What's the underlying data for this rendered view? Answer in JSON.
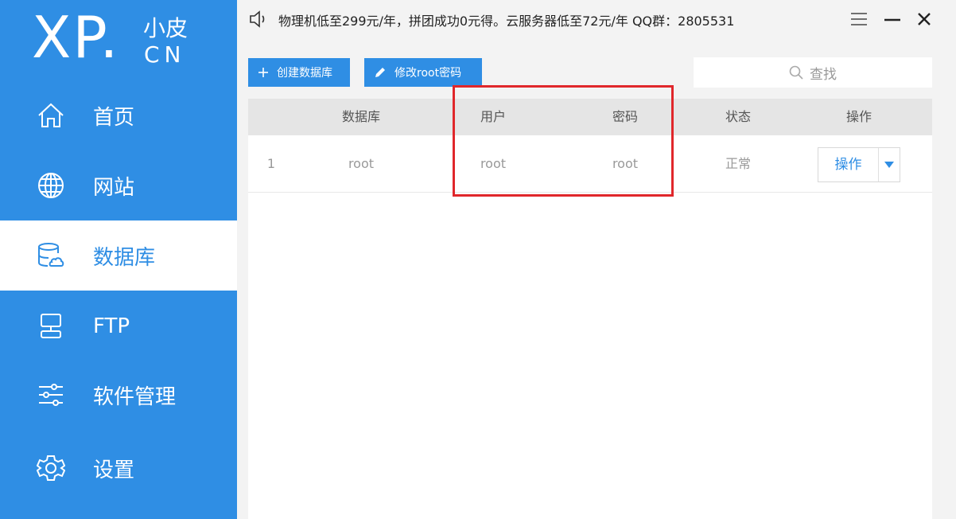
{
  "logo": {
    "main": "XP",
    "dot": ".",
    "top": "小皮",
    "bottom": "CN"
  },
  "sidebar": {
    "items": [
      {
        "label": "首页",
        "icon": "home-icon"
      },
      {
        "label": "网站",
        "icon": "globe-icon"
      },
      {
        "label": "数据库",
        "icon": "database-icon",
        "active": true
      },
      {
        "label": "FTP",
        "icon": "ftp-icon"
      },
      {
        "label": "软件管理",
        "icon": "sliders-icon"
      },
      {
        "label": "设置",
        "icon": "gear-icon"
      }
    ]
  },
  "topbar": {
    "notice": "物理机低至299元/年，拼团成功0元得。云服务器低至72元/年  QQ群：2805531"
  },
  "toolbar": {
    "create_label": "创建数据库",
    "modify_label": "修改root密码"
  },
  "search": {
    "placeholder": "查找"
  },
  "table": {
    "headers": [
      "数据库",
      "用户",
      "密码",
      "状态",
      "操作"
    ],
    "rows": [
      {
        "index": "1",
        "database": "root",
        "user": "root",
        "password": "root",
        "status": "正常",
        "action": "操作"
      }
    ]
  },
  "colors": {
    "accent": "#2f8ee4",
    "highlight": "#e0272b"
  }
}
